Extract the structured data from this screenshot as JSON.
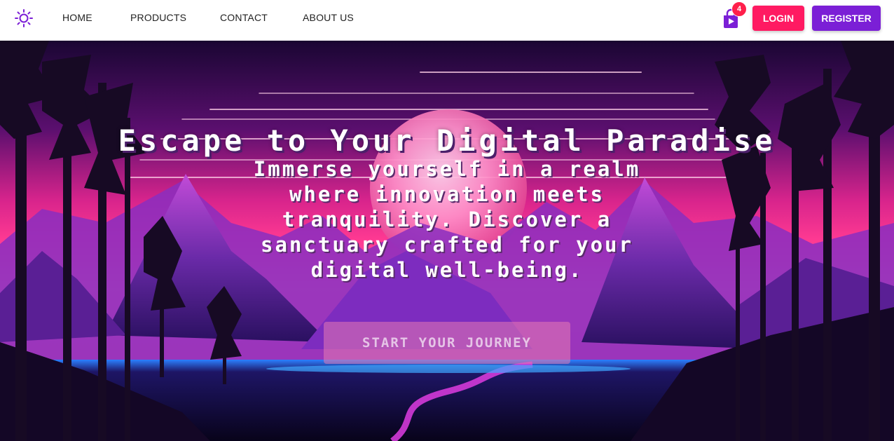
{
  "navbar": {
    "theme_toggle_icon": "sun-icon",
    "links": [
      "HOME",
      "PRODUCTS",
      "CONTACT",
      "ABOUT US"
    ],
    "cart": {
      "icon": "shopping-bag-icon",
      "count": "4"
    },
    "login_label": "LOGIN",
    "register_label": "REGISTER"
  },
  "hero": {
    "title": "Escape to Your Digital Paradise",
    "subtitle": "Immerse yourself in a realm where innovation meets tranquility. Discover a sanctuary crafted for your digital well-being.",
    "cta_label": "START YOUR JOURNEY"
  },
  "colors": {
    "accent_purple": "#7b1fd6",
    "login_pink": "#ff1a62",
    "badge_red": "#ff1f4b",
    "hero_sky_top": "#1a0633",
    "hero_sky_horizon": "#ff3a92"
  }
}
